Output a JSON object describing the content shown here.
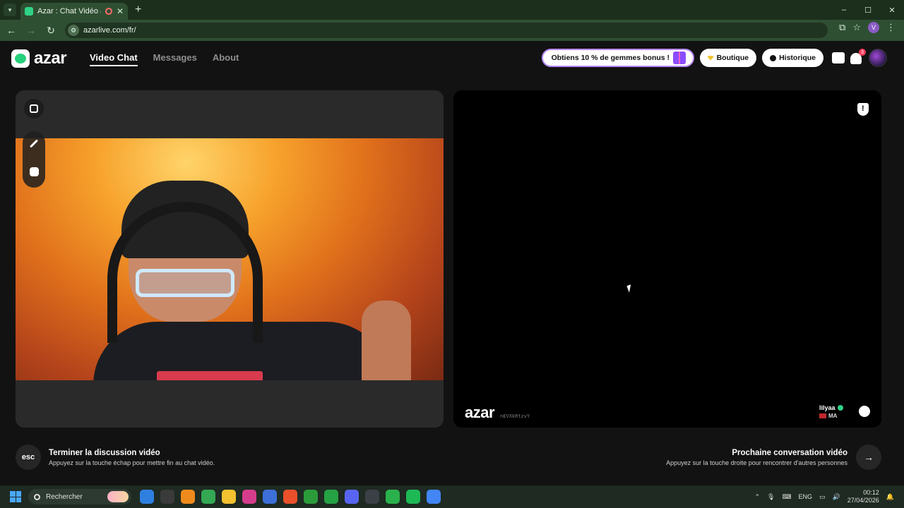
{
  "browser": {
    "tab_title": "Azar : Chat Vidéo avec de n",
    "tab_close": "✕",
    "new_tab": "+",
    "url": "azarlive.com/fr/",
    "profile_initial": "V",
    "window_controls": [
      "–",
      "☐",
      "✕"
    ]
  },
  "app": {
    "logo_text": "azar",
    "nav": {
      "video_chat": "Video Chat",
      "messages": "Messages",
      "about": "About"
    },
    "promo": "Obtiens 10 % de gemmes bonus !",
    "boutique": "Boutique",
    "historique": "Historique",
    "notification_count": "3"
  },
  "video": {
    "watermark_logo": "azar",
    "watermark_code": "nEVXkRtzvY",
    "partner_name": "lilyaa",
    "partner_country": "MA"
  },
  "shortcuts": {
    "esc_key": "esc",
    "end_title": "Terminer la discussion vidéo",
    "end_sub": "Appuyez sur la touche échap pour mettre fin au chat vidéo.",
    "next_title": "Prochaine conversation vidéo",
    "next_sub": "Appuyez sur la touche droite pour rencontrer d'autres personnes",
    "next_arrow": "→"
  },
  "taskbar": {
    "search_placeholder": "Rechercher",
    "language": "ENG",
    "time": "00:12",
    "date": "27/04/2026",
    "apps": [
      {
        "name": "security-app",
        "color": "#2f7fe0"
      },
      {
        "name": "mail-app",
        "color": "#3a3a3a"
      },
      {
        "name": "vlc-app",
        "color": "#f08a1c"
      },
      {
        "name": "chrome-app",
        "color": "#34a853"
      },
      {
        "name": "file-explorer-app",
        "color": "#f2c230"
      },
      {
        "name": "instagram-app",
        "color": "#d63c8c"
      },
      {
        "name": "store-app",
        "color": "#3d6fd8"
      },
      {
        "name": "brave-app",
        "color": "#e9502b"
      },
      {
        "name": "xbox-app",
        "color": "#2c9b3a"
      },
      {
        "name": "whatsapp-app",
        "color": "#25a244"
      },
      {
        "name": "discord-app",
        "color": "#5865f2"
      },
      {
        "name": "steam-app",
        "color": "#3b3f46"
      },
      {
        "name": "media-app",
        "color": "#2ab14c"
      },
      {
        "name": "spotify-app",
        "color": "#1db954"
      },
      {
        "name": "chrome-profile-app",
        "color": "#4285f4"
      }
    ]
  }
}
